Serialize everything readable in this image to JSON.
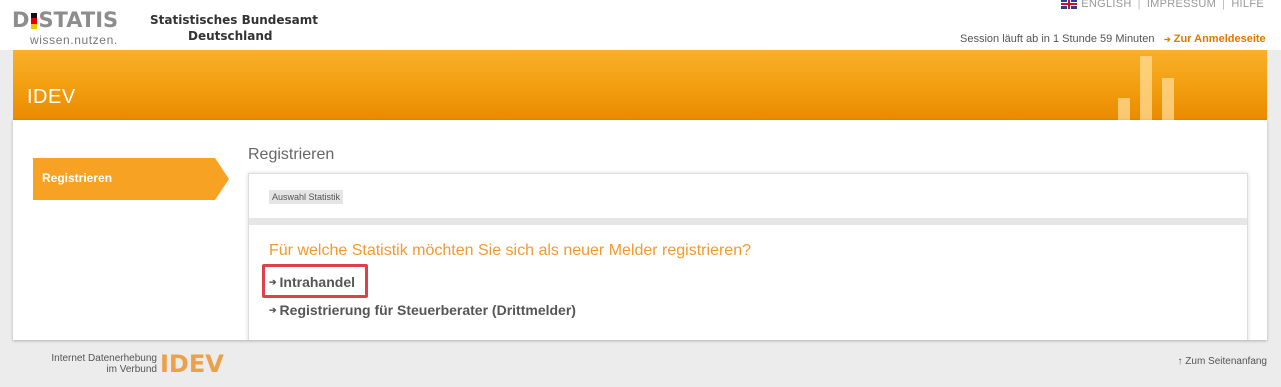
{
  "colors": {
    "accent": "#f29d10",
    "link_accent": "#e07800",
    "question": "#f29a2e",
    "highlight": "#e0404a"
  },
  "logo": {
    "word": "DSTATIS",
    "word_prefix": "D",
    "word_suffix": "STATIS",
    "tagline": "wissen.nutzen.",
    "org_line1": "Statistisches Bundesamt",
    "org_line2": "Deutschland"
  },
  "toplinks": {
    "english": "ENGLISH",
    "impressum": "IMPRESSUM",
    "hilfe": "HILFE",
    "sep": "|",
    "flag_icon": "uk-flag-icon"
  },
  "session": {
    "text": "Session läuft ab in 1 Stunde 59 Minuten",
    "login_link": "Zur Anmeldeseite",
    "login_arrow": "➔"
  },
  "header": {
    "title": "IDEV"
  },
  "nav": {
    "active_item": "Registrieren"
  },
  "main": {
    "page_title": "Registrieren",
    "breadcrumb": "Auswahl Statistik",
    "question": "Für welche Statistik möchten Sie sich als neuer Melder registrieren?",
    "links": [
      {
        "label": "Intrahandel",
        "arrow": "➔",
        "highlighted": true
      },
      {
        "label": "Registrierung für Steuerberater (Drittmelder)",
        "arrow": "➔",
        "highlighted": false
      }
    ]
  },
  "footer": {
    "brand_line1": "Internet Datenerhebung",
    "brand_line2": "im Verbund",
    "brand_word": "IDEV",
    "top_link": "↑ Zum Seitenanfang"
  }
}
